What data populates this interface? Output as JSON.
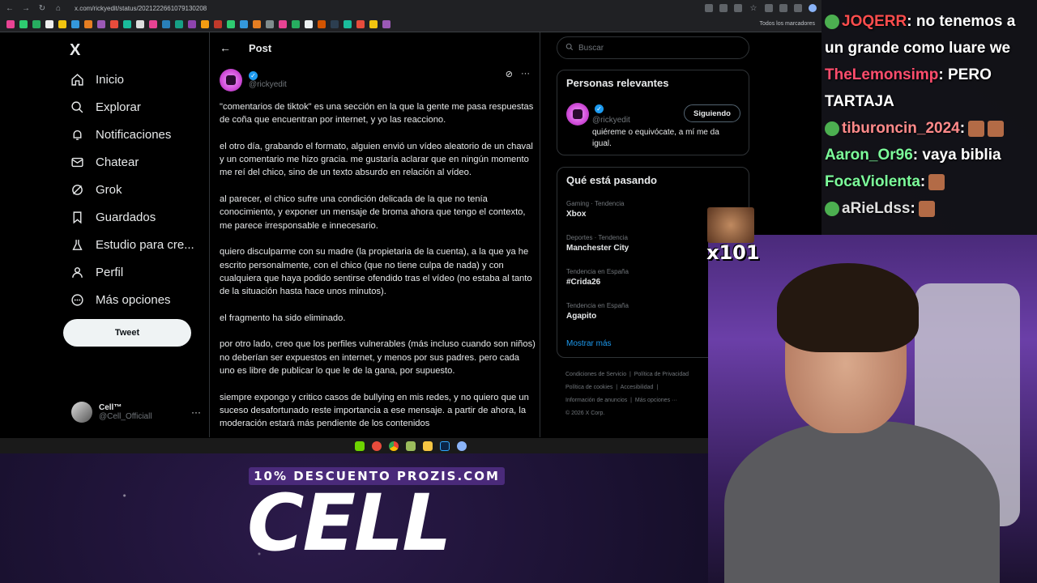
{
  "browser": {
    "url": "x.com/rickyedit/status/2021222661079130208",
    "bookmarks_folder": "Todos los marcadores"
  },
  "sidebar": {
    "logo": "X",
    "items": [
      {
        "label": "Inicio"
      },
      {
        "label": "Explorar"
      },
      {
        "label": "Notificaciones"
      },
      {
        "label": "Chatear"
      },
      {
        "label": "Grok"
      },
      {
        "label": "Guardados"
      },
      {
        "label": "Estudio para cre..."
      },
      {
        "label": "Perfil"
      },
      {
        "label": "Más opciones"
      }
    ],
    "tweet_button": "Tweet",
    "account": {
      "name": "Cell™",
      "handle": "@Cell_Officiall"
    }
  },
  "post": {
    "header_title": "Post",
    "author_handle": "@rickyedit",
    "paragraphs": [
      "\"comentarios de tiktok\" es una sección en la que la gente me pasa respuestas de coña que encuentran por internet, y yo las reacciono.",
      "el otro día, grabando el formato, alguien envió un vídeo aleatorio de un chaval y un comentario me hizo gracia. me gustaría aclarar que en ningún momento me reí del chico, sino de un texto absurdo en relación al vídeo.",
      "al parecer, el chico sufre una condición delicada de la que no tenía conocimiento, y exponer un mensaje de broma ahora que tengo el contexto, me parece irresponsable e innecesario.",
      "quiero disculparme con su madre (la propietaria de la cuenta), a la que ya he escrito personalmente, con el chico (que no tiene culpa de nada) y con cualquiera que haya podido sentirse ofendido tras el vídeo (no estaba al tanto de la situación hasta hace unos minutos).",
      "el fragmento ha sido eliminado.",
      "por otro lado, creo que los perfiles vulnerables (más incluso cuando son niños) no deberían ser expuestos en internet, y menos por sus padres. pero cada uno es libre de publicar lo que le de la gana, por supuesto.",
      "siempre expongo y critico casos de bullying en mis redes, y no quiero que un suceso desafortunado reste importancia a ese mensaje. a partir de ahora, la moderación estará más pendiente de los contenidos"
    ]
  },
  "right": {
    "search_placeholder": "Buscar",
    "relevant_title": "Personas relevantes",
    "relevant_handle": "@rickyedit",
    "follow_label": "Siguiendo",
    "relevant_bio": "quiéreme o equivócate, a mí me da igual.",
    "trends_title": "Qué está pasando",
    "trends": [
      {
        "category": "Gaming · Tendencia",
        "name": "Xbox"
      },
      {
        "category": "Deportes · Tendencia",
        "name": "Manchester City"
      },
      {
        "category": "Tendencia en España",
        "name": "#Crida26"
      },
      {
        "category": "Tendencia en España",
        "name": "Agapito"
      }
    ],
    "show_more": "Mostrar más",
    "footer": [
      "Condiciones de Servicio",
      "Política de Privacidad",
      "Política de cookies",
      "Accesibilidad",
      "Información de anuncios",
      "Más opciones ···",
      "© 2026 X Corp."
    ]
  },
  "chat": [
    {
      "user": "JOQERR",
      "color": "#ff4d4d",
      "text": ": no tenemos a un grande como luare we",
      "badge": true
    },
    {
      "user": "TheLemonsimp",
      "color": "#ff4d6d",
      "text": ": PERO TARTAJA",
      "badge": false
    },
    {
      "user": "tiburoncin_2024",
      "color": "#ff8a8a",
      "text": ":",
      "badge": true,
      "emotes": 2
    },
    {
      "user": "Aaron_Or96",
      "color": "#7CFC9A",
      "text": ": vaya biblia",
      "badge": false
    },
    {
      "user": "FocaViolenta",
      "color": "#7CFC9A",
      "text": ":",
      "badge": false,
      "emotes": 1
    },
    {
      "user": "aRieLdss",
      "color": "#e0e0e0",
      "text": ":",
      "badge": true,
      "emotes": 1
    }
  ],
  "overlay": {
    "emote_count": "x101",
    "sponsor_text": "10% DESCUENTO PROZIS.COM",
    "brand": "CELL"
  }
}
